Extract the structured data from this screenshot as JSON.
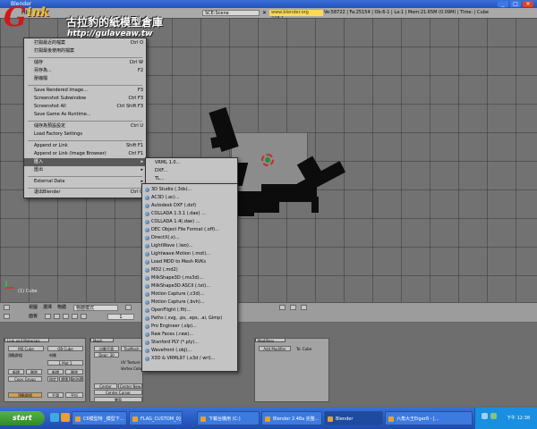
{
  "window": {
    "title": "Blender"
  },
  "header": {
    "menus": [
      "File",
      "Add"
    ],
    "scene_field": "SCE:Scene",
    "url": "www.blender.org 248.1",
    "stats": "Ve:58722 | Fa:25154 | Ob:6-1 | La:1 | Mem:21.65M (0.09M) | Time:  | Cube"
  },
  "watermark": {
    "brand_g": "G",
    "brand_wink": "ink",
    "title": "古拉豹的紙模型倉庫",
    "url": "http://gulaveaw.tw"
  },
  "file_menu": {
    "items": [
      {
        "label": "打開最近的檔案",
        "shortcut": "Ctrl O",
        "arrow": ""
      },
      {
        "label": "打開最後使用的檔案",
        "shortcut": "",
        "arrow": ""
      },
      {
        "label": "儲存",
        "shortcut": "Ctrl W",
        "arrow": ""
      },
      {
        "label": "另存為...",
        "shortcut": "F2",
        "arrow": ""
      },
      {
        "label": "壓縮檔",
        "shortcut": "",
        "arrow": ""
      },
      {
        "label": "Save Rendered Image...",
        "shortcut": "F3",
        "arrow": ""
      },
      {
        "label": "Screenshot Subwindow",
        "shortcut": "Ctrl F3",
        "arrow": ""
      },
      {
        "label": "Screenshot All",
        "shortcut": "Ctrl Shift F3",
        "arrow": ""
      },
      {
        "label": "Save Game As Runtime...",
        "shortcut": "",
        "arrow": ""
      },
      {
        "label": "儲存為預設設定",
        "shortcut": "Ctrl U",
        "arrow": ""
      },
      {
        "label": "Load Factory Settings",
        "shortcut": "",
        "arrow": ""
      },
      {
        "label": "Append or Link",
        "shortcut": "Shift F1",
        "arrow": ""
      },
      {
        "label": "Append or Link (Image Browser)",
        "shortcut": "Ctrl F1",
        "arrow": ""
      },
      {
        "label": "匯入",
        "shortcut": "",
        "arrow": "▸"
      },
      {
        "label": "匯出",
        "shortcut": "",
        "arrow": "▸"
      },
      {
        "label": "External Data",
        "shortcut": "",
        "arrow": "▸"
      },
      {
        "label": "退出Blender",
        "shortcut": "Ctrl Q",
        "arrow": ""
      }
    ]
  },
  "import_submenu": {
    "items": [
      "VRML 1.0...",
      "DXF...",
      "TL..."
    ]
  },
  "python_import_menu": {
    "items": [
      "3D Studio (.3ds)...",
      "AC3D (.ac)...",
      "Autodesk DXF (.dxf)",
      "COLLADA 1.3.1 (.dae) ...",
      "COLLADA 1.4(.dae) ...",
      "DEC Object File Format (.off)...",
      "DirectX(.x)...",
      "LightWave (.lwo)...",
      "Lightwave Motion (.mot)...",
      "Load MDD to Mesh RVKs",
      "MD2 (.md2)",
      "MilkShape3D (.ms3d)...",
      "MilkShape3D ASCII (.txt)...",
      "Motion Capture (.c3d)...",
      "Motion Capture (.bvh)...",
      "OpenFlight (.flt)...",
      "Paths (.svg, .ps, .eps, .ai, Gimp)",
      "Pro Engineer (.slp)...",
      "Raw Faces (.raw)...",
      "Stanford PLY (*.ply)...",
      "Wavefront (.obj)...",
      "X3D & VRML97 (.x3d / wrl)..."
    ]
  },
  "viewport": {
    "object_label": "(1) Cube"
  },
  "view3d_header": {
    "menus": [
      "視圖",
      "選擇",
      "物體"
    ],
    "mode": "物體模式"
  },
  "buttons_header": {
    "panels_label": "面板",
    "frame": "1"
  },
  "buttons": {
    "link_panel": {
      "tab": "Link and Materials",
      "me": "ME:Cube",
      "ob": "OB:Cube",
      "vgroups": "頂點群組",
      "mat": "材質",
      "slot": "1 Mat 1",
      "new": "新增",
      "delete": "刪除",
      "copy_group": "Copy Group",
      "assign": "指定",
      "select": "選擇",
      "deselect": "取消選擇",
      "set_smooth": "平滑",
      "set_solid": "平坦"
    },
    "mesh_panel": {
      "tab": "Mesh",
      "auto_smooth": "自動平滑",
      "degr": "Degr: 30",
      "texmesh": "TexMesh",
      "uv_tex": "UV Texture",
      "vertex_col": "Vertex Color",
      "center": "Center",
      "center_new": "Center New",
      "center_cursor": "Center Cursor",
      "double_sided": "雙面",
      "no_v_normal_flip": "No V.Normal Flip"
    },
    "modifiers_panel": {
      "tab": "Modifiers",
      "add": "Add Modifier",
      "to": "To: Cube"
    }
  },
  "taskbar": {
    "start": "start",
    "tasks": [
      "C6模型特 _模型下...",
      "FLAG_CUSTOM_0]",
      "下載台機用 (C:)",
      "Blender 2.48a 完整...",
      "Blender",
      "六角大王Eiger8 - [..."
    ],
    "clock": "下午 12:38"
  }
}
